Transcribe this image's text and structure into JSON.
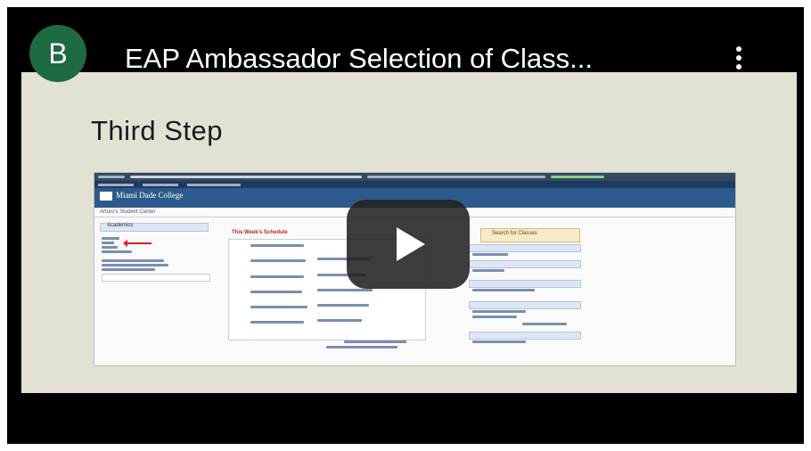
{
  "video": {
    "channel_initial": "B",
    "title": "EAP Ambassador Selection of Class...",
    "play_icon": "play-icon",
    "menu_icon": "kebab-menu-icon"
  },
  "slide": {
    "heading": "Third Step"
  },
  "embedded_screenshot": {
    "logo": "Miami Dade College",
    "breadcrumb": "Arturo's Student Center",
    "section": "Academics",
    "schedule_heading": "This Week's Schedule",
    "search_button": "Search for Classes"
  },
  "colors": {
    "avatar": "#1e6b42",
    "slide_background": "#e3e1d4",
    "player_background": "#000000"
  }
}
